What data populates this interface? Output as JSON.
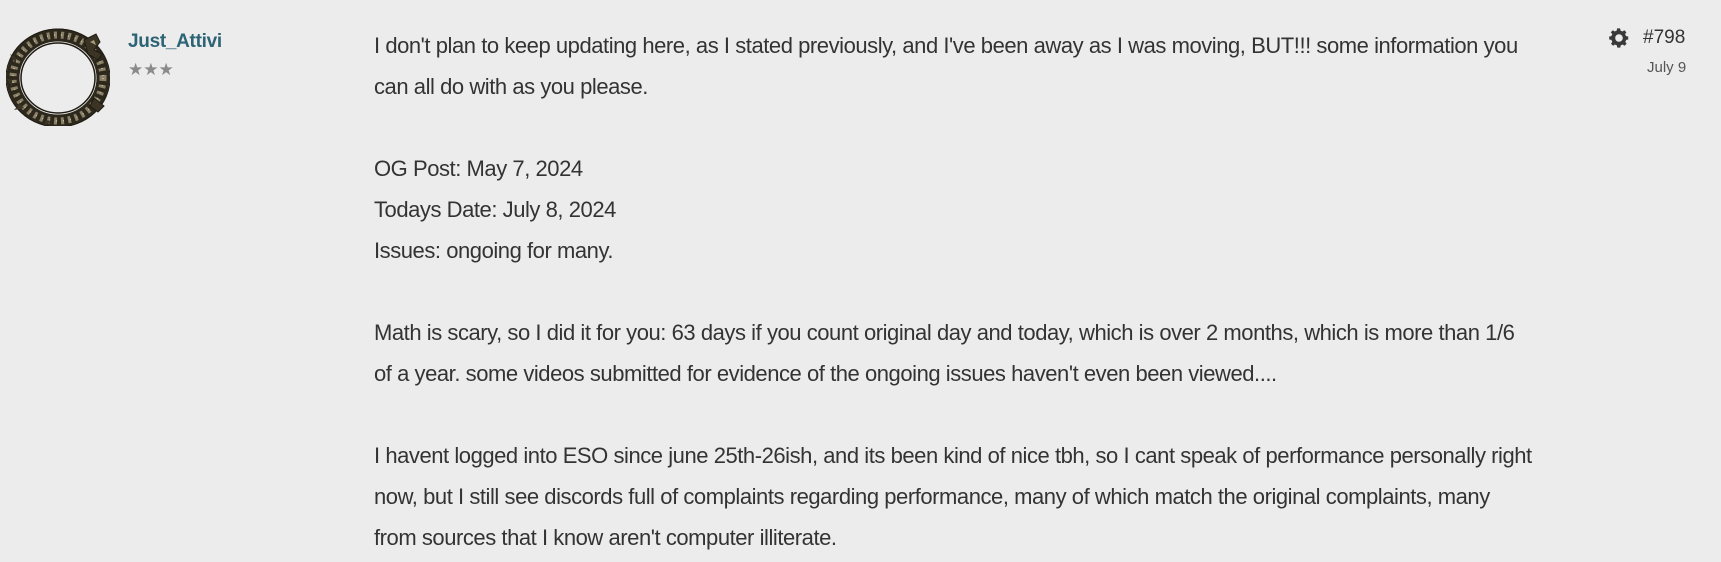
{
  "author": {
    "username": "Just_Attivi",
    "rank_stars": "★★★",
    "avatar": "elder-scrolls-ouroboros-avatar"
  },
  "post": {
    "number": "#798",
    "date": "July 9",
    "options_icon": "gear-icon",
    "paragraphs": [
      [
        "I don't plan to keep updating here, as I stated previously, and I've been away as I was moving, BUT!!! some information you",
        "can all do with as you please."
      ],
      [
        "OG Post: May 7, 2024",
        "Todays Date: July 8, 2024",
        "Issues: ongoing for many."
      ],
      [
        "Math is scary, so I did it for you: 63 days if you count original day and today, which is over 2 months, which is more than 1/6",
        "of a year. some videos submitted for evidence of the ongoing issues haven't even been viewed...."
      ],
      [
        "I havent logged into ESO since june 25th-26ish, and its been kind of nice tbh, so I cant speak of performance personally right",
        "now, but I still see discords full of complaints regarding performance, many of which match the original complaints, many",
        "from sources that I know aren't computer illiterate."
      ]
    ]
  }
}
